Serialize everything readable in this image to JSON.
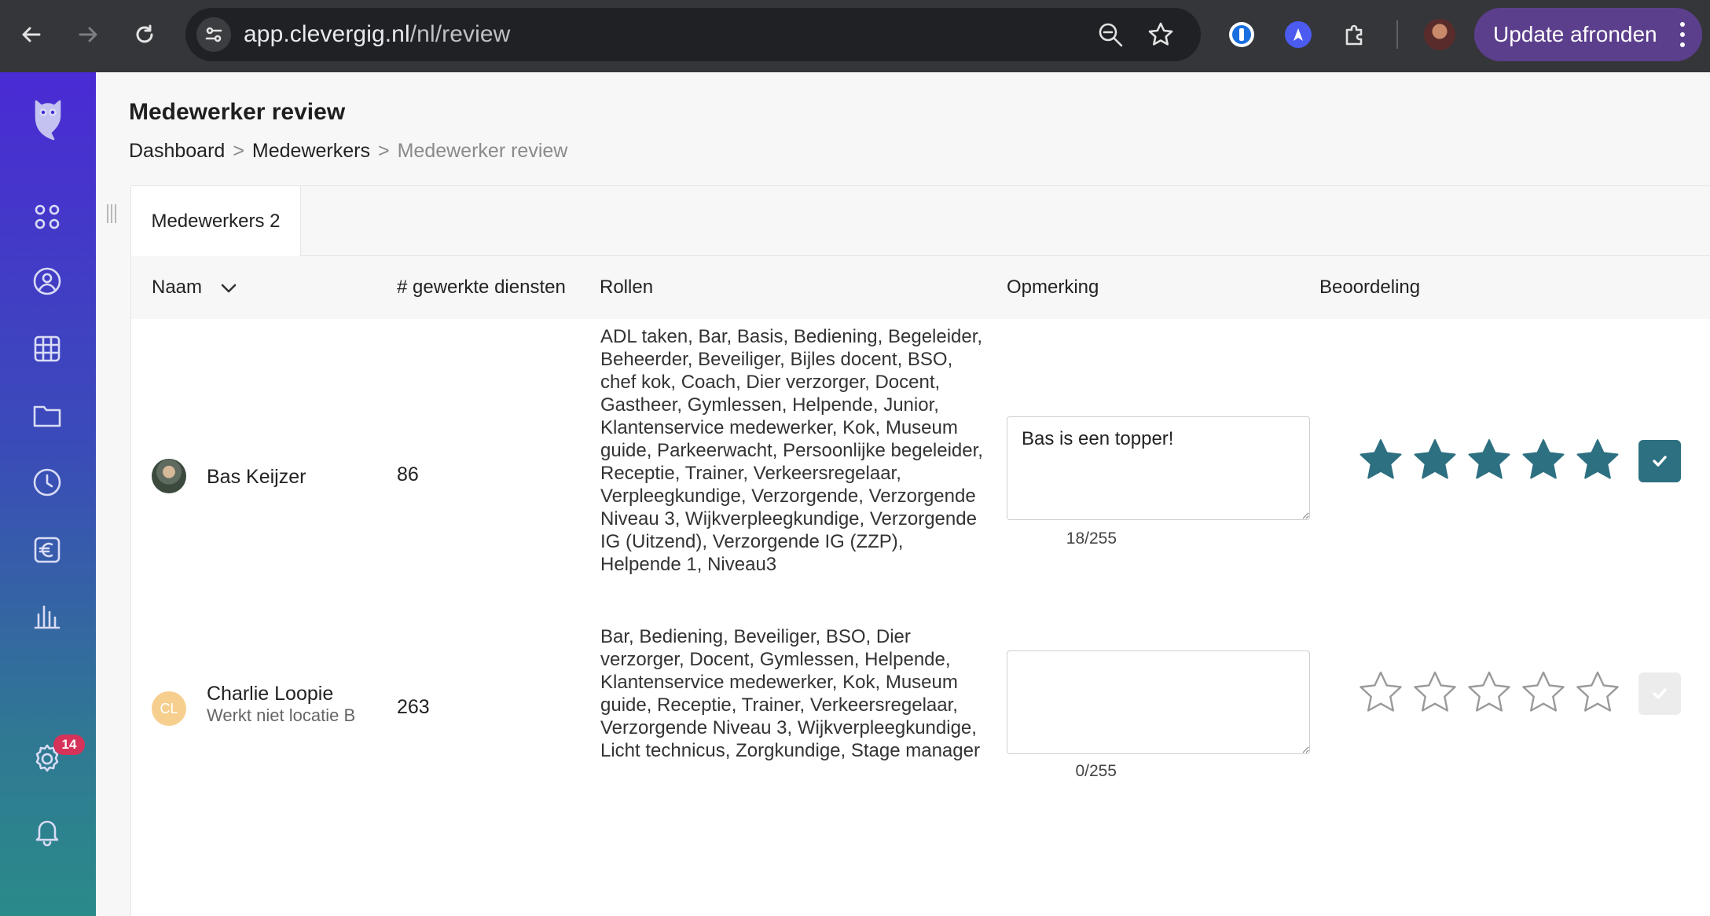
{
  "browser": {
    "url_host": "app.clevergig.nl",
    "url_path": "/nl/review",
    "update_button_label": "Update afronden"
  },
  "sidebar": {
    "notification_count": "14"
  },
  "page": {
    "title": "Medewerker review",
    "breadcrumb": [
      "Dashboard",
      ">",
      "Medewerkers",
      ">",
      "Medewerker review"
    ]
  },
  "tabs": [
    {
      "label": "Medewerkers 2"
    }
  ],
  "table": {
    "columns": {
      "name": "Naam",
      "shifts": "# gewerkte diensten",
      "roles": "Rollen",
      "remark": "Opmerking",
      "rating": "Beoordeling"
    },
    "rows": [
      {
        "name": "Bas Keijzer",
        "subtitle": "",
        "initials": "",
        "shifts": "86",
        "roles": "ADL taken, Bar, Basis, Bediening, Begeleider, Beheerder, Beveiliger, Bijles docent, BSO, chef kok, Coach, Dier verzorger, Docent, Gastheer, Gymlessen, Helpende, Junior, Klantenservice medewerker, Kok, Museum guide, Parkeerwacht, Persoonlijke begeleider, Receptie, Trainer, Verkeersregelaar, Verpleegkundige, Verzorgende, Verzorgende Niveau 3, Wijkverpleegkundige, Verzorgende IG (Uitzend), Verzorgende IG (ZZP), Helpende 1, Niveau3",
        "remark": "Bas is een topper!",
        "char_count": "18/255",
        "rating": 5,
        "rating_max": 5
      },
      {
        "name": "Charlie Loopie",
        "subtitle": "Werkt niet locatie B",
        "initials": "CL",
        "shifts": "263",
        "roles": "Bar, Bediening, Beveiliger, BSO, Dier verzorger, Docent, Gymlessen, Helpende, Klantenservice medewerker, Kok, Museum guide, Receptie, Trainer, Verkeersregelaar, Verzorgende Niveau 3, Wijkverpleegkundige, Licht technicus, Zorgkundige, Stage manager",
        "remark": "",
        "char_count": "0/255",
        "rating": 0,
        "rating_max": 5
      }
    ]
  },
  "colors": {
    "accent": "#2d7081",
    "sidebar_top": "#4a2bd4",
    "sidebar_bottom": "#2a8a8a",
    "badge": "#d6335a",
    "update_button": "#5c3f8c"
  }
}
